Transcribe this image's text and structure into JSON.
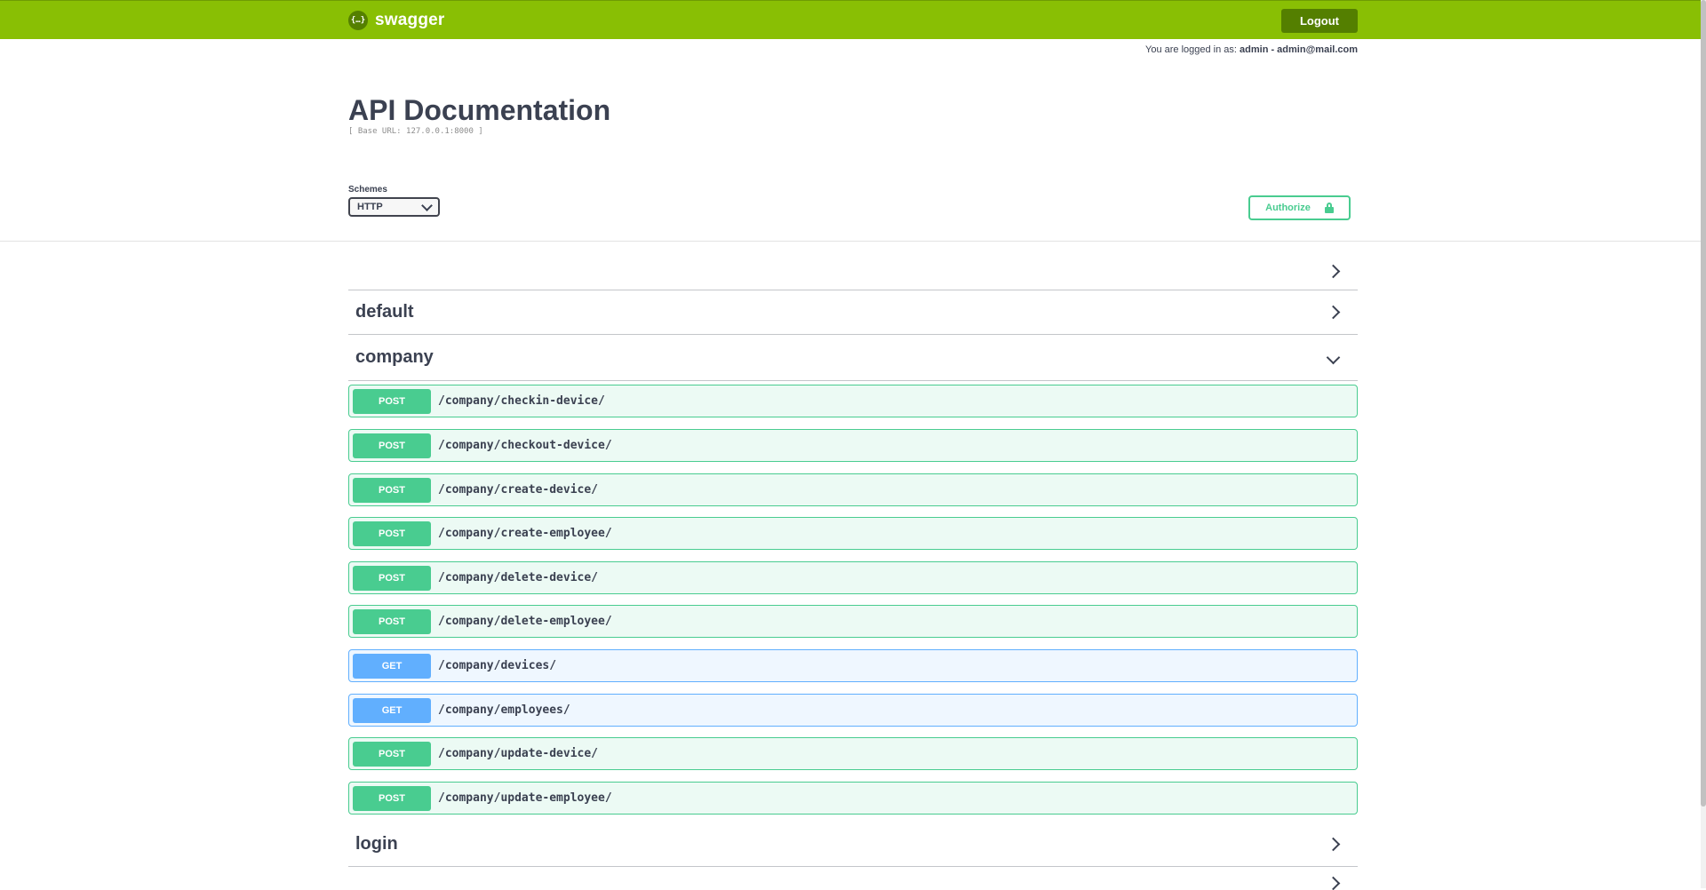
{
  "topbar": {
    "brand_logo": "{…}",
    "brand_name": "swagger",
    "logout_label": "Logout"
  },
  "login_info": {
    "prefix": "You are logged in as:",
    "user": "admin - admin@mail.com"
  },
  "info": {
    "title": "API Documentation",
    "base_url": "[ Base URL: 127.0.0.1:8000 ]"
  },
  "schemes": {
    "label": "Schemes",
    "selected": "HTTP"
  },
  "authorize_label": "Authorize",
  "sections": {
    "unnamed": "",
    "default": "default",
    "company": "company",
    "login": "login"
  },
  "operations": [
    {
      "method": "POST",
      "path": "/company/checkin-device/"
    },
    {
      "method": "POST",
      "path": "/company/checkout-device/"
    },
    {
      "method": "POST",
      "path": "/company/create-device/"
    },
    {
      "method": "POST",
      "path": "/company/create-employee/"
    },
    {
      "method": "POST",
      "path": "/company/delete-device/"
    },
    {
      "method": "POST",
      "path": "/company/delete-employee/"
    },
    {
      "method": "GET",
      "path": "/company/devices/"
    },
    {
      "method": "GET",
      "path": "/company/employees/"
    },
    {
      "method": "POST",
      "path": "/company/update-device/"
    },
    {
      "method": "POST",
      "path": "/company/update-employee/"
    }
  ],
  "colors": {
    "topbar": "#89bf04",
    "post": "#49cc90",
    "get": "#61affe"
  }
}
